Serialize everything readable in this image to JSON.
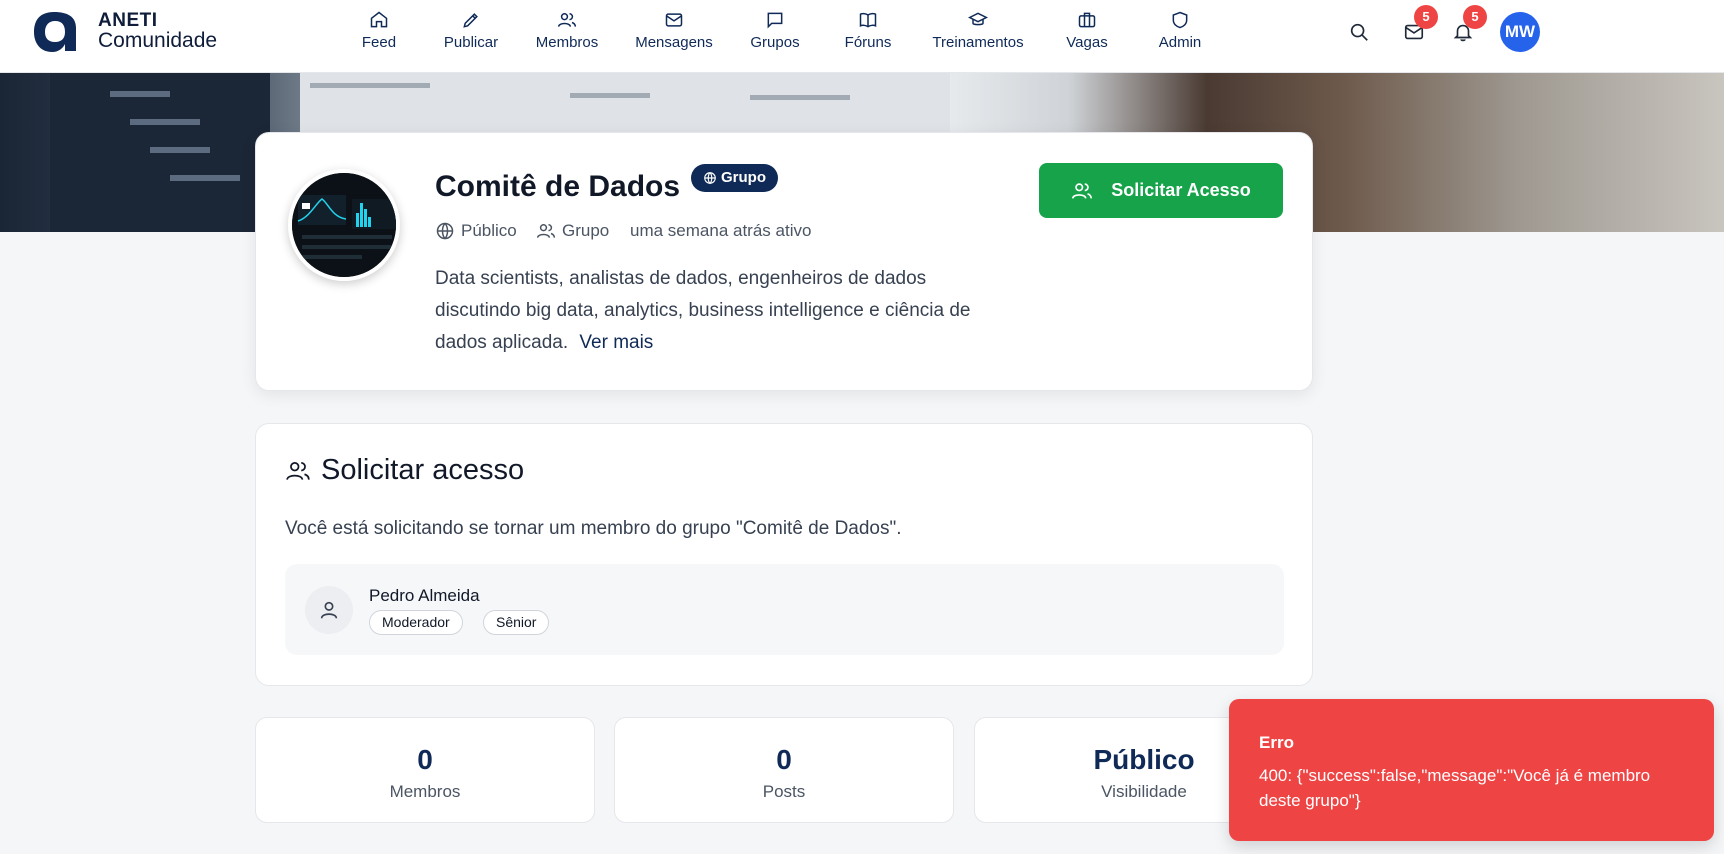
{
  "app": {
    "logo_line1": "ANETI",
    "logo_line2": "Comunidade"
  },
  "nav": {
    "items": [
      {
        "label": "Feed",
        "icon": "home-icon"
      },
      {
        "label": "Publicar",
        "icon": "pen-icon"
      },
      {
        "label": "Membros",
        "icon": "users-icon"
      },
      {
        "label": "Mensagens",
        "icon": "mail-icon"
      },
      {
        "label": "Grupos",
        "icon": "chat-icon"
      },
      {
        "label": "Fóruns",
        "icon": "book-icon"
      },
      {
        "label": "Treinamentos",
        "icon": "graduation-cap-icon"
      },
      {
        "label": "Vagas",
        "icon": "briefcase-icon"
      },
      {
        "label": "Admin",
        "icon": "shield-icon"
      }
    ],
    "messages_badge": "5",
    "notifications_badge": "5",
    "user_initials": "MW"
  },
  "group": {
    "title": "Comitê de Dados",
    "type_pill": "Grupo",
    "visibility": "Público",
    "kind": "Grupo",
    "activity": "uma semana atrás ativo",
    "description": "Data scientists, analistas de dados, engenheiros de dados discutindo big data, analytics, business intelligence e ciência de dados aplicada.",
    "see_more": "Ver mais",
    "request_button": "Solicitar Acesso"
  },
  "request": {
    "title": "Solicitar acesso",
    "text": "Você está solicitando se tornar um membro do grupo \"Comitê de Dados\".",
    "user": {
      "name": "Pedro Almeida",
      "tags": [
        "Moderador",
        "Sênior"
      ]
    }
  },
  "stats": [
    {
      "value": "0",
      "label": "Membros"
    },
    {
      "value": "0",
      "label": "Posts"
    },
    {
      "value": "Público",
      "label": "Visibilidade"
    }
  ],
  "toast": {
    "title": "Erro",
    "message": "400: {\"success\":false,\"message\":\"Você já é membro deste grupo\"}"
  },
  "colors": {
    "brand_navy": "#0f2a57",
    "success_green": "#16a34a",
    "error_red": "#ef4444",
    "avatar_blue": "#2563eb"
  }
}
